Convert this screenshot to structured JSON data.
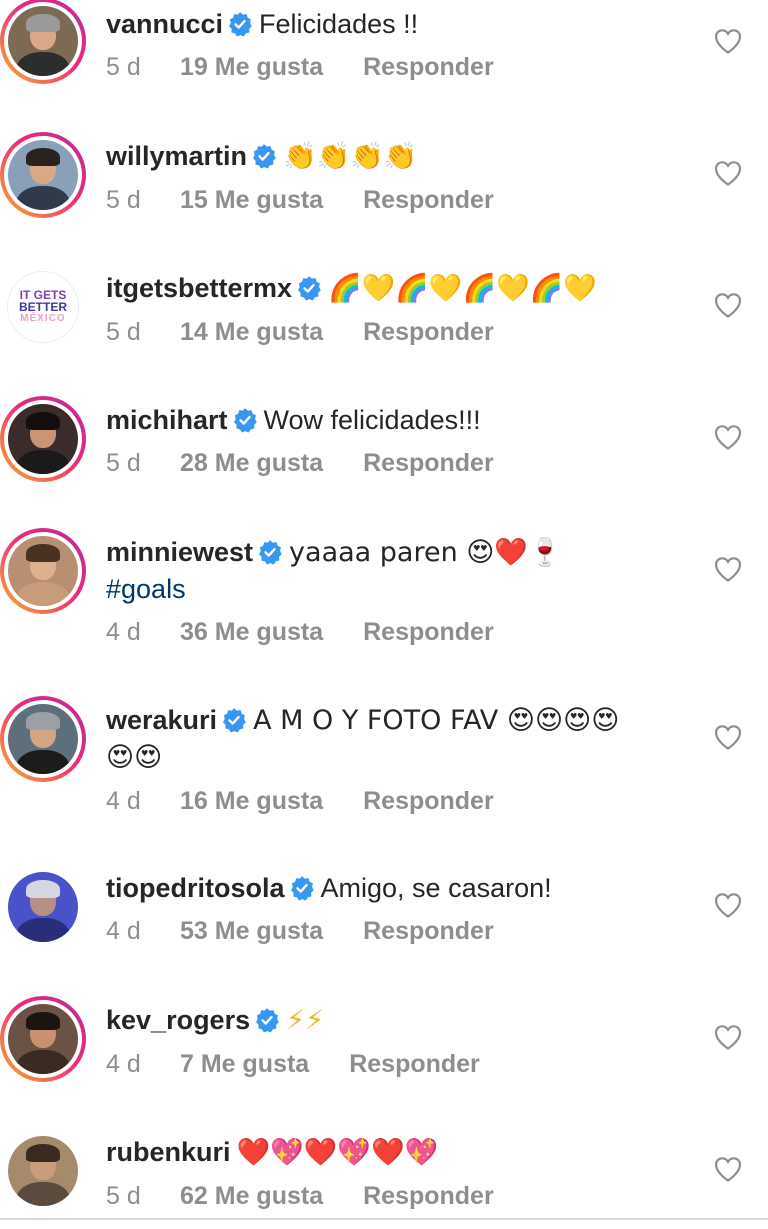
{
  "comments": [
    {
      "username": "vannucci",
      "text": "Felicidades !!",
      "text2": "",
      "time": "5 d",
      "likes": "19 Me gusta",
      "reply": "Responder",
      "ring": true,
      "avatar_bg": "#7d6a55"
    },
    {
      "username": "willymartin",
      "text": "👏👏👏👏",
      "text2": "",
      "time": "5 d",
      "likes": "15 Me gusta",
      "reply": "Responder",
      "ring": true,
      "avatar_bg": "#8aa0b8"
    },
    {
      "username": "itgetsbettermx",
      "text": "🌈💛🌈💛🌈💛🌈💛",
      "text2": "",
      "time": "5 d",
      "likes": "14 Me gusta",
      "reply": "Responder",
      "ring": false,
      "avatar_logo": [
        "IT GETS",
        "BETTER",
        "MÉXICO"
      ]
    },
    {
      "username": "michihart",
      "text": "Wow felicidades!!!",
      "text2": "",
      "time": "5 d",
      "likes": "28 Me gusta",
      "reply": "Responder",
      "ring": true,
      "avatar_bg": "#3b2b2a"
    },
    {
      "username": "minniewest",
      "text": "yaaaa paren 😍❤️🍷",
      "text2": "#goals",
      "time": "4 d",
      "likes": "36 Me gusta",
      "reply": "Responder",
      "ring": true,
      "avatar_bg": "#b88f72"
    },
    {
      "username": "werakuri",
      "text": "A M O Y FOTO FAV 😍😍😍😍",
      "text2": "😍😍",
      "time": "4 d",
      "likes": "16 Me gusta",
      "reply": "Responder",
      "ring": true,
      "avatar_bg": "#5d6f7b"
    },
    {
      "username": "tiopedritosola",
      "text": "Amigo, se casaron!",
      "text2": "",
      "time": "4 d",
      "likes": "53 Me gusta",
      "reply": "Responder",
      "ring": false,
      "avatar_bg": "#4a52c9"
    },
    {
      "username": "kev_rogers",
      "text": "⚡⚡",
      "text2": "",
      "time": "4 d",
      "likes": "7 Me gusta",
      "reply": "Responder",
      "ring": true,
      "avatar_bg": "#6b5244"
    },
    {
      "username": "rubenkuri",
      "text": "❤️💖❤️💖❤️💖",
      "text2": "",
      "time": "5 d",
      "likes": "62 Me gusta",
      "reply": "Responder",
      "ring": false,
      "avatar_bg": "#a58a6c"
    }
  ],
  "colors": {
    "verified": "#3897f0",
    "meta": "#8e8e8e",
    "hashtag": "#00376b",
    "heart_outline": "#8e8e8e"
  },
  "icons": {
    "verified": "verified-badge-icon",
    "like": "heart-outline-icon"
  }
}
